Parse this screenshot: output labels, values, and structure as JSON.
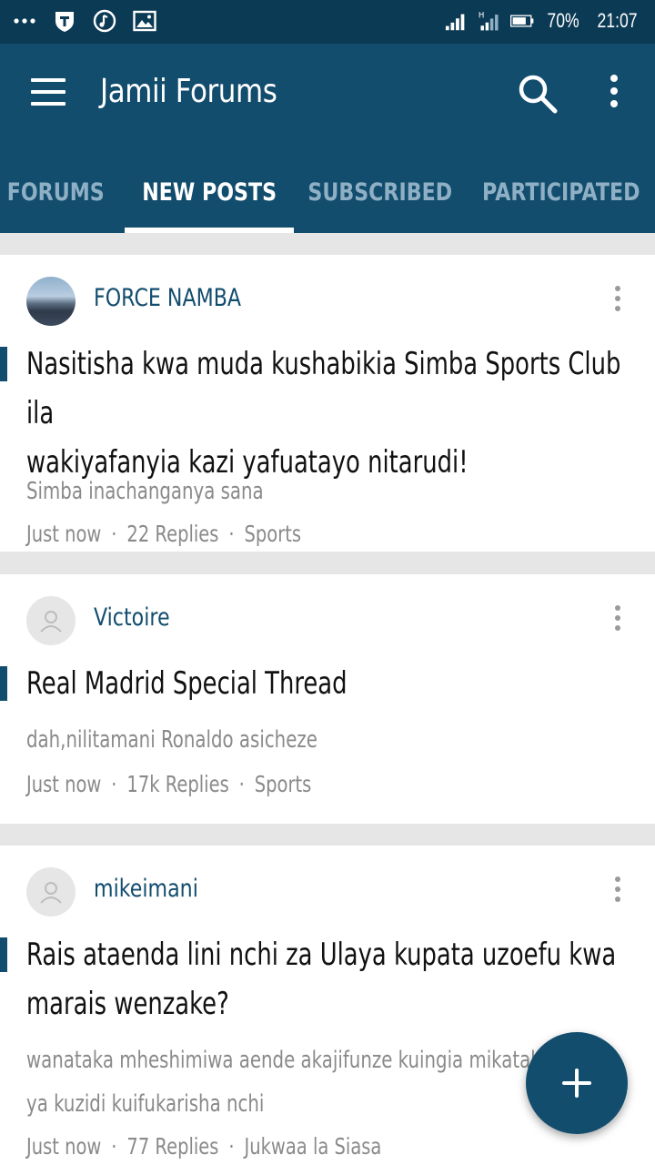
{
  "status_bar": {
    "left_icons": [
      "more-dots-icon",
      "shield-icon",
      "music-icon",
      "image-icon"
    ],
    "battery": "70%",
    "time": "21:07"
  },
  "app_bar": {
    "title": "Jamii Forums"
  },
  "tabs": [
    {
      "label": "FORUMS",
      "active": false
    },
    {
      "label": "NEW POSTS",
      "active": true
    },
    {
      "label": "SUBSCRIBED",
      "active": false
    },
    {
      "label": "PARTICIPATED",
      "active": false
    }
  ],
  "posts": [
    {
      "author": "FORCE NAMBA",
      "avatar": "photo",
      "title_lines": [
        "Nasitisha kwa muda kushabikia Simba Sports Club ila",
        "wakiyafanyia kazi yafuatayo nitarudi!"
      ],
      "snippet_lines": [
        "Simba inachanganya sana"
      ],
      "time": "Just now",
      "replies": "22 Replies",
      "forum": "Sports"
    },
    {
      "author": "Victoire",
      "avatar": "placeholder",
      "title_lines": [
        "Real Madrid Special Thread"
      ],
      "snippet_lines": [
        "dah,nilitamani Ronaldo asicheze"
      ],
      "time": "Just now",
      "replies": "17k Replies",
      "forum": "Sports"
    },
    {
      "author": "mikeimani",
      "avatar": "placeholder",
      "title_lines": [
        "Rais ataenda lini nchi za Ulaya kupata uzoefu kwa",
        "marais wenzake?"
      ],
      "snippet_lines": [
        "wanataka mheshimiwa aende akajifunze kuingia mikataba",
        "ya kuzidi kuifukarisha nchi"
      ],
      "time": "Just now",
      "replies": "77 Replies",
      "forum": "Jukwaa la Siasa"
    }
  ],
  "meta_separator": "·",
  "fab": {
    "icon": "plus-icon"
  },
  "colors": {
    "primary": "#124d6e",
    "status_bar": "#0b3a54",
    "background": "#e6e6e6"
  }
}
